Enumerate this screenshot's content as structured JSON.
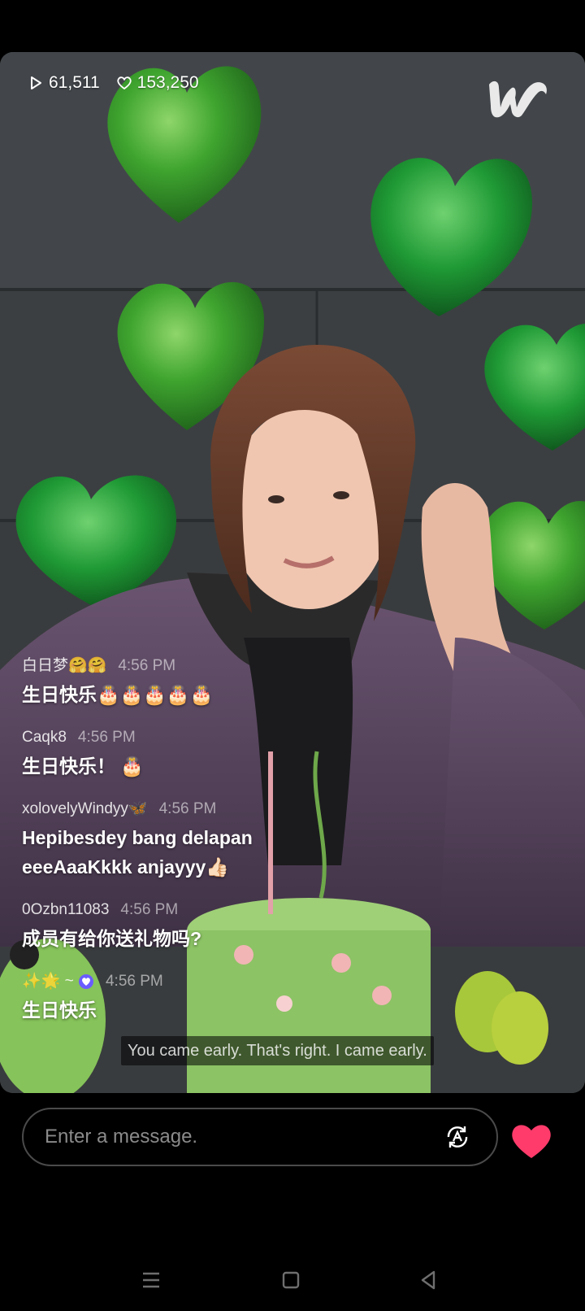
{
  "stats": {
    "views": "61,511",
    "likes": "153,250"
  },
  "chat": [
    {
      "user": "白日梦🤗🤗",
      "time": "4:56 PM",
      "text": "生日快乐🎂🎂🎂🎂🎂"
    },
    {
      "user": "Caqk8",
      "time": "4:56 PM",
      "text": "生日快乐！ 🎂"
    },
    {
      "user": "xolovelyWindyy🦋",
      "time": "4:56 PM",
      "text": "Hepibesdey bang delapan eeeAaaKkkk anjayyy👍🏻"
    },
    {
      "user": "0Ozbn11083",
      "time": "4:56 PM",
      "text": "成员有给你送礼物吗?"
    },
    {
      "user": "✨🌟 ~",
      "time": "4:56 PM",
      "text": "生日快乐",
      "badge": "verified-heart-icon"
    }
  ],
  "subtitle": "You came early. That's right. I came early.",
  "input": {
    "placeholder": "Enter a message."
  },
  "colors": {
    "heart": "#ff3b6b",
    "balloon": "#3a9a2e",
    "background": "#000000"
  }
}
